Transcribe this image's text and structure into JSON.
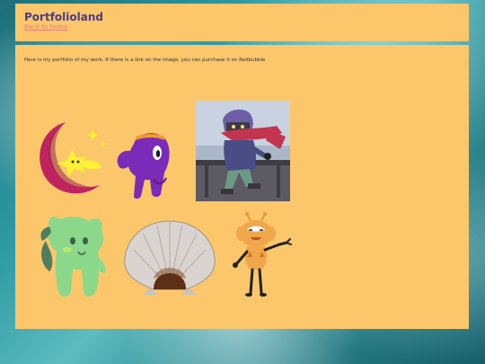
{
  "header": {
    "title": "Portfolioland",
    "back_link": "Back to home"
  },
  "main": {
    "intro": "Here is my portfolio of my work. If there is a link on the image, you can purchase it on Redbubble"
  },
  "gallery": [
    {
      "name": "moon-star-character-art"
    },
    {
      "name": "purple-blob-character-art"
    },
    {
      "name": "scarf-character-art"
    },
    {
      "name": "green-creature-art"
    },
    {
      "name": "seashell-art"
    },
    {
      "name": "orange-bug-character-art"
    }
  ]
}
